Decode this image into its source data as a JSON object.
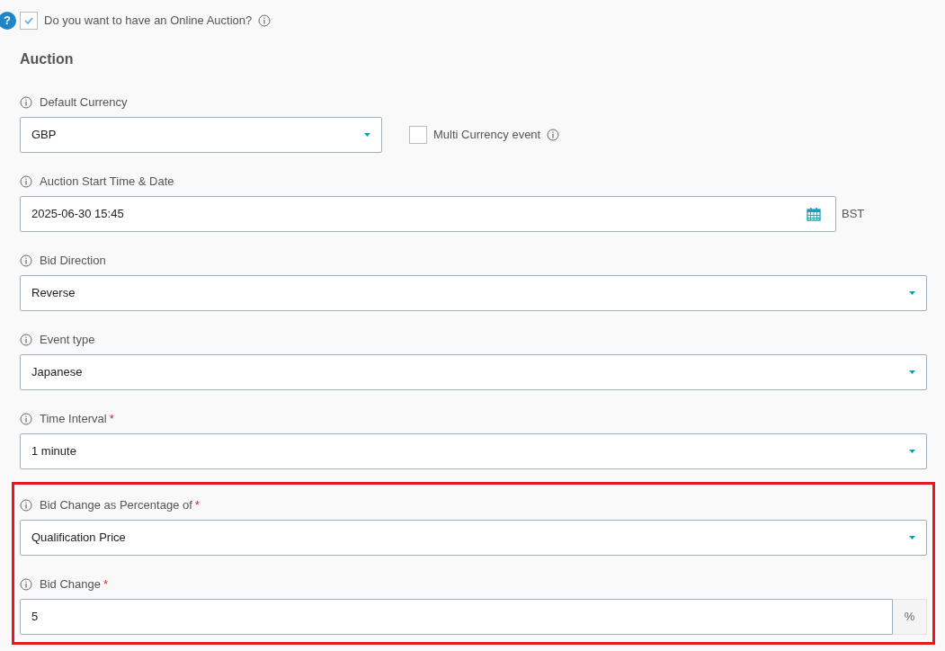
{
  "online_auction": {
    "label": "Do you want to have an Online Auction?",
    "checked": true,
    "help_icon": "?"
  },
  "section_title": "Auction",
  "groups": [
    {
      "highlighted": false,
      "fields": [
        {
          "kind": "select",
          "label": "Default Currency",
          "value": "GBP",
          "side_checkbox": {
            "label": "Multi Currency event",
            "checked": false
          }
        },
        {
          "kind": "datetime",
          "label": "Auction Start Time & Date",
          "value": "2025-06-30 15:45",
          "suffix": "BST"
        },
        {
          "kind": "select",
          "label": "Bid Direction",
          "value": "Reverse"
        },
        {
          "kind": "select",
          "label": "Event type",
          "value": "Japanese"
        },
        {
          "kind": "select",
          "label": "Time Interval",
          "required_mark": "*",
          "value": "1 minute"
        }
      ]
    },
    {
      "highlighted": true,
      "fields": [
        {
          "kind": "select",
          "label": "Bid Change as Percentage of",
          "required_mark": "*",
          "value": "Qualification Price"
        },
        {
          "kind": "addon",
          "label": "Bid Change",
          "required_mark": "*",
          "value": "5",
          "addon": "%"
        }
      ]
    }
  ]
}
